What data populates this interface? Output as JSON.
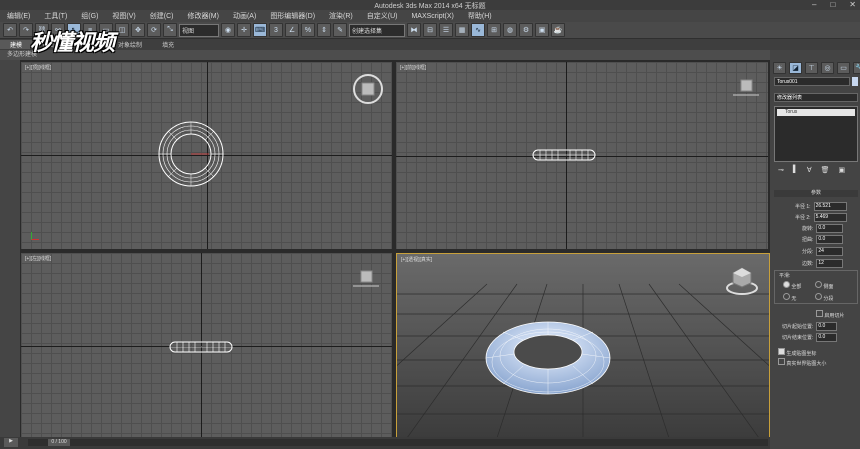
{
  "window": {
    "title": "Autodesk 3ds Max  2014 x64     无标题"
  },
  "menu": [
    "编辑(E)",
    "工具(T)",
    "组(G)",
    "视图(V)",
    "创建(C)",
    "修改器(M)",
    "动画(A)",
    "图形编辑器(D)",
    "渲染(R)",
    "自定义(U)",
    "MAXScript(X)",
    "帮助(H)"
  ],
  "toolbar": {
    "view_select": "视图",
    "selection_set": "创建选择集"
  },
  "ribbon": {
    "tabs": [
      "建模",
      "自由形式",
      "选择",
      "对象绘制",
      "填充"
    ],
    "subtitle": "多边形建模"
  },
  "watermark": "秒懂视频",
  "viewports": {
    "top": "[+][顶][线框]",
    "front": "[+][前][线框]",
    "left": "[+][左][线框]",
    "persp": "[+][透视][真实]"
  },
  "command_panel": {
    "object_name": "Torus001",
    "modifier_list": "修改器列表",
    "stack_item": "Torus",
    "rollout": "参数",
    "radius1_label": "半径 1:",
    "radius1": "26.521",
    "radius2_label": "半径 2:",
    "radius2": "5.469",
    "rotation_label": "旋转:",
    "rotation": "0.0",
    "twist_label": "扭曲:",
    "twist": "0.0",
    "segments_label": "分段:",
    "segments": "24",
    "sides_label": "边数:",
    "sides": "12",
    "smooth_label": "平滑:",
    "smooth_all": "全部",
    "smooth_sides": "侧面",
    "smooth_none": "无",
    "smooth_segments": "分段",
    "slice_on": "启用切片",
    "slice_from": "切片起始位置:",
    "slice_from_val": "0.0",
    "slice_to": "切片结束位置:",
    "slice_to_val": "0.0",
    "gen_uv": "生成贴图坐标",
    "real_world": "真实世界贴图大小"
  },
  "status": {
    "frame": "0 / 100"
  },
  "colors": {
    "viewport_grid": "#5d5d5d",
    "active_border": "#c8a03a",
    "accent": "#9ab8d8"
  }
}
